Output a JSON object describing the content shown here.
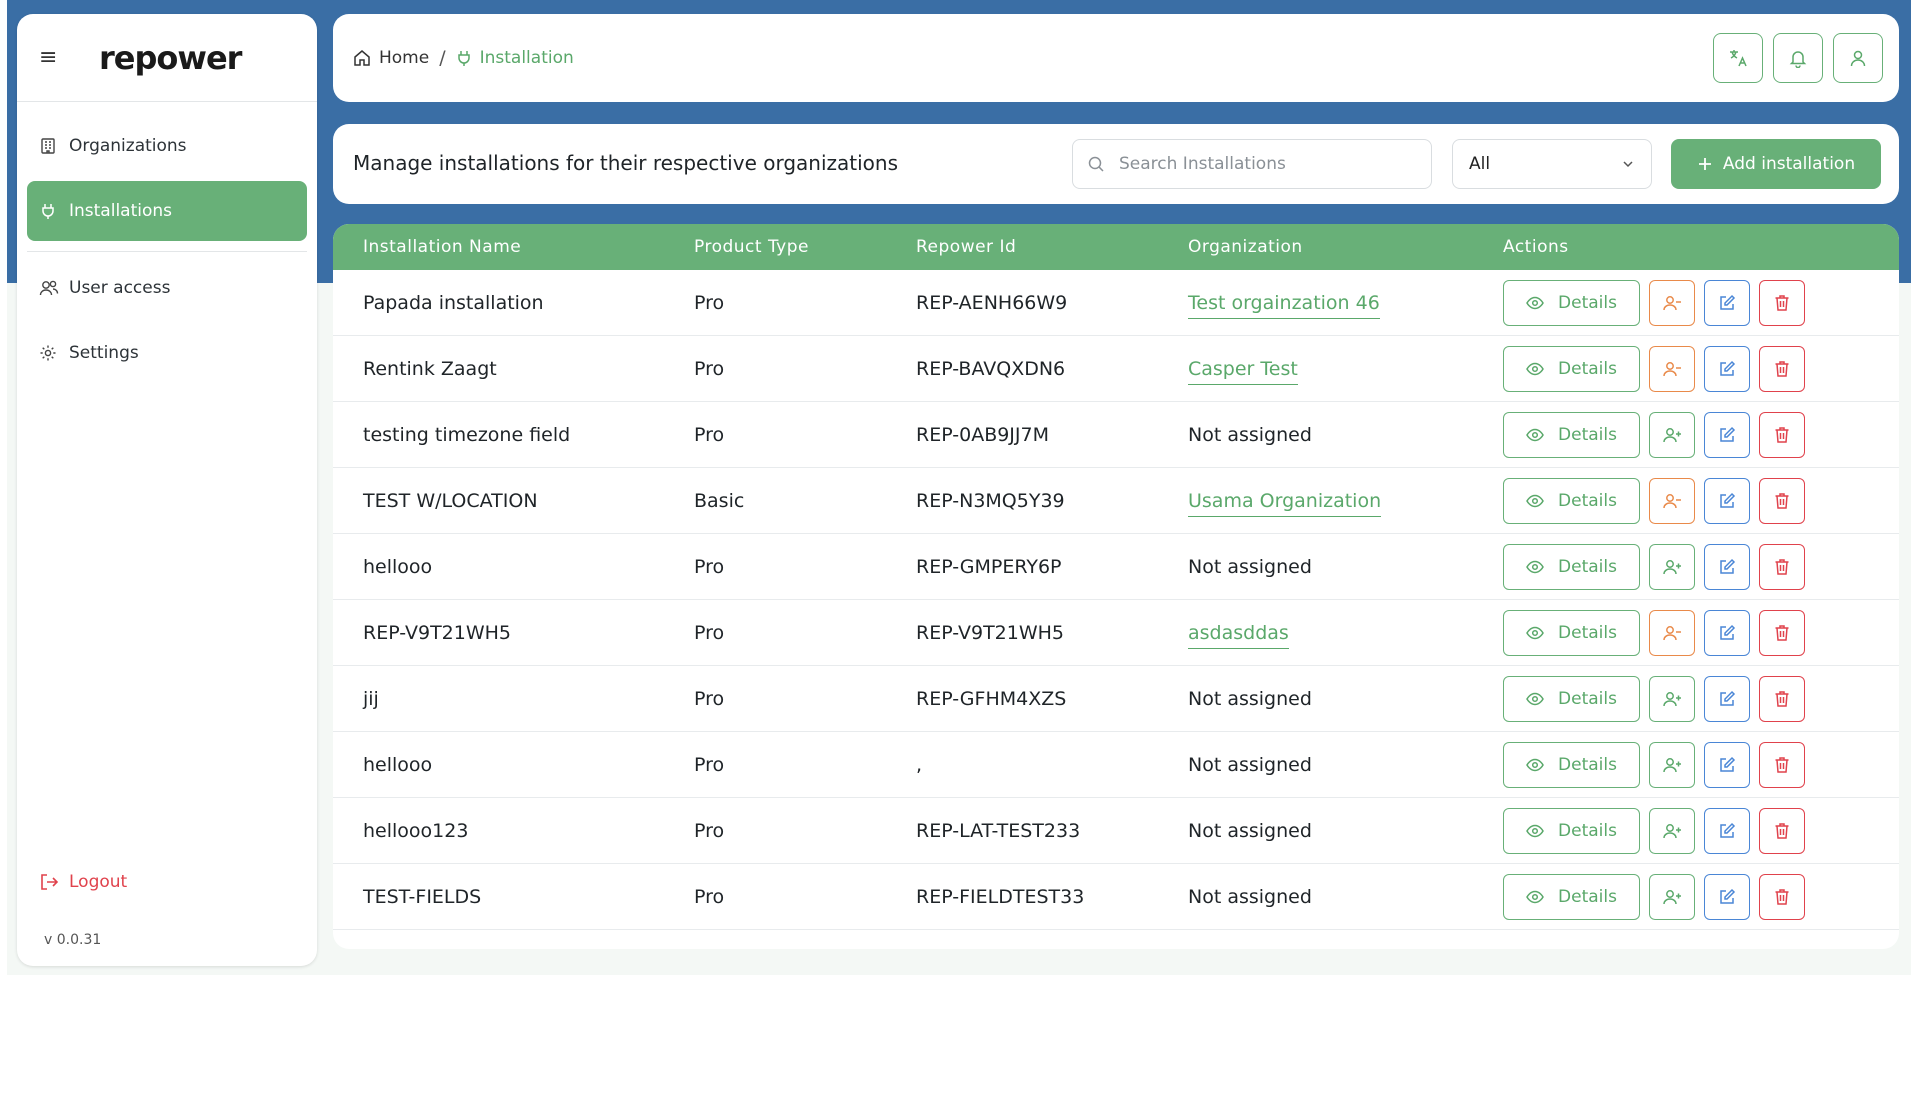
{
  "app": {
    "logo": "repower",
    "version": "v 0.0.31"
  },
  "sidebar": {
    "items": [
      {
        "label": "Organizations",
        "icon": "building-icon",
        "active": false
      },
      {
        "label": "Installations",
        "icon": "plug-icon",
        "active": true
      },
      {
        "label": "User access",
        "icon": "users-icon",
        "active": false
      },
      {
        "label": "Settings",
        "icon": "gear-icon",
        "active": false
      }
    ],
    "logout_label": "Logout"
  },
  "breadcrumb": {
    "home": "Home",
    "separator": "/",
    "current": "Installation"
  },
  "toolbar": {
    "title": "Manage installations for their respective organizations",
    "search_placeholder": "Search Installations",
    "filter_value": "All",
    "add_label": "Add installation"
  },
  "table": {
    "headers": [
      "Installation Name",
      "Product Type",
      "Repower Id",
      "Organization",
      "Actions"
    ],
    "details_label": "Details",
    "rows": [
      {
        "name": "Papada installation",
        "type": "Pro",
        "repower_id": "REP-AENH66W9",
        "organization": "Test orgainzation 46",
        "assigned": true
      },
      {
        "name": "Rentink Zaagt",
        "type": "Pro",
        "repower_id": "REP-BAVQXDN6",
        "organization": "Casper Test",
        "assigned": true
      },
      {
        "name": "testing timezone field",
        "type": "Pro",
        "repower_id": "REP-0AB9JJ7M",
        "organization": "Not assigned",
        "assigned": false
      },
      {
        "name": "TEST W/LOCATION",
        "type": "Basic",
        "repower_id": "REP-N3MQ5Y39",
        "organization": "Usama Organization",
        "assigned": true
      },
      {
        "name": "hellooo",
        "type": "Pro",
        "repower_id": "REP-GMPERY6P",
        "organization": "Not assigned",
        "assigned": false
      },
      {
        "name": "REP-V9T21WH5",
        "type": "Pro",
        "repower_id": "REP-V9T21WH5",
        "organization": "asdasddas",
        "assigned": true
      },
      {
        "name": "jij",
        "type": "Pro",
        "repower_id": "REP-GFHM4XZS",
        "organization": "Not assigned",
        "assigned": false
      },
      {
        "name": "hellooo",
        "type": "Pro",
        "repower_id": ",",
        "organization": "Not assigned",
        "assigned": false
      },
      {
        "name": "hellooo123",
        "type": "Pro",
        "repower_id": "REP-LAT-TEST233",
        "organization": "Not assigned",
        "assigned": false
      },
      {
        "name": "TEST-FIELDS",
        "type": "Pro",
        "repower_id": "REP-FIELDTEST33",
        "organization": "Not assigned",
        "assigned": false
      }
    ]
  },
  "colors": {
    "brand": "#68b078",
    "link": "#5aa86a",
    "header_bg": "#3a6ea5",
    "danger": "#e0424c",
    "edit": "#4a86d6",
    "unassign": "#e98a4a"
  }
}
